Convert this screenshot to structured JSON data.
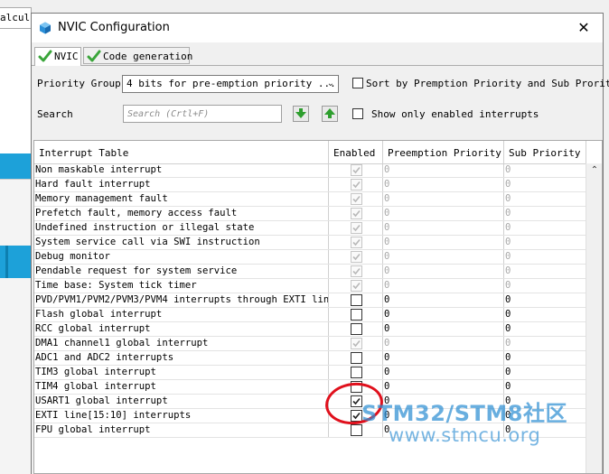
{
  "background": {
    "field_text": "alcul"
  },
  "dialog": {
    "title": "NVIC Configuration",
    "close_glyph": "✕"
  },
  "tabs": [
    {
      "label": "NVIC",
      "active": true
    },
    {
      "label": "Code generation",
      "active": false
    }
  ],
  "controls": {
    "priority_group_label": "Priority Group",
    "priority_group_value": "4 bits for pre-emption priority ...",
    "sort_label": "Sort by Premption Priority and Sub Prority",
    "search_label": "Search",
    "search_placeholder": "Search (Crtl+F)",
    "show_only_label": "Show only enabled interrupts"
  },
  "table": {
    "headers": [
      "Interrupt Table",
      "Enabled",
      "Preemption Priority",
      "Sub Priority"
    ],
    "rows": [
      {
        "name": "Non maskable interrupt",
        "enabled": true,
        "locked": true,
        "preemption": "0",
        "sub": "0"
      },
      {
        "name": "Hard fault interrupt",
        "enabled": true,
        "locked": true,
        "preemption": "0",
        "sub": "0"
      },
      {
        "name": "Memory management fault",
        "enabled": true,
        "locked": true,
        "preemption": "0",
        "sub": "0"
      },
      {
        "name": "Prefetch fault, memory access fault",
        "enabled": true,
        "locked": true,
        "preemption": "0",
        "sub": "0"
      },
      {
        "name": "Undefined instruction or illegal state",
        "enabled": true,
        "locked": true,
        "preemption": "0",
        "sub": "0"
      },
      {
        "name": "System service call via SWI instruction",
        "enabled": true,
        "locked": true,
        "preemption": "0",
        "sub": "0"
      },
      {
        "name": "Debug monitor",
        "enabled": true,
        "locked": true,
        "preemption": "0",
        "sub": "0"
      },
      {
        "name": "Pendable request for system service",
        "enabled": true,
        "locked": true,
        "preemption": "0",
        "sub": "0"
      },
      {
        "name": "Time base: System tick timer",
        "enabled": true,
        "locked": true,
        "preemption": "0",
        "sub": "0"
      },
      {
        "name": "PVD/PVM1/PVM2/PVM3/PVM4 interrupts through EXTI lin...",
        "enabled": false,
        "locked": false,
        "preemption": "0",
        "sub": "0"
      },
      {
        "name": "Flash global interrupt",
        "enabled": false,
        "locked": false,
        "preemption": "0",
        "sub": "0"
      },
      {
        "name": "RCC global interrupt",
        "enabled": false,
        "locked": false,
        "preemption": "0",
        "sub": "0"
      },
      {
        "name": "DMA1 channel1 global interrupt",
        "enabled": true,
        "locked": true,
        "preemption": "0",
        "sub": "0"
      },
      {
        "name": "ADC1 and ADC2 interrupts",
        "enabled": false,
        "locked": false,
        "preemption": "0",
        "sub": "0"
      },
      {
        "name": "TIM3 global interrupt",
        "enabled": false,
        "locked": false,
        "preemption": "0",
        "sub": "0"
      },
      {
        "name": "TIM4 global interrupt",
        "enabled": false,
        "locked": false,
        "preemption": "0",
        "sub": "0"
      },
      {
        "name": "USART1 global interrupt",
        "enabled": true,
        "locked": false,
        "preemption": "0",
        "sub": "0"
      },
      {
        "name": "EXTI line[15:10] interrupts",
        "enabled": true,
        "locked": false,
        "preemption": "0",
        "sub": "0"
      },
      {
        "name": "FPU global interrupt",
        "enabled": false,
        "locked": false,
        "preemption": "0",
        "sub": "0"
      }
    ]
  },
  "watermark": {
    "line1": "STM32/STM8社区",
    "line2": "www.stmcu.org"
  },
  "colors": {
    "accent_blue": "#1da1d9",
    "annotation_red": "#e0101c",
    "watermark_blue": "#2f8fd3",
    "tab_check_green": "#3aa53a",
    "arrow_green": "#2e9e2e"
  }
}
